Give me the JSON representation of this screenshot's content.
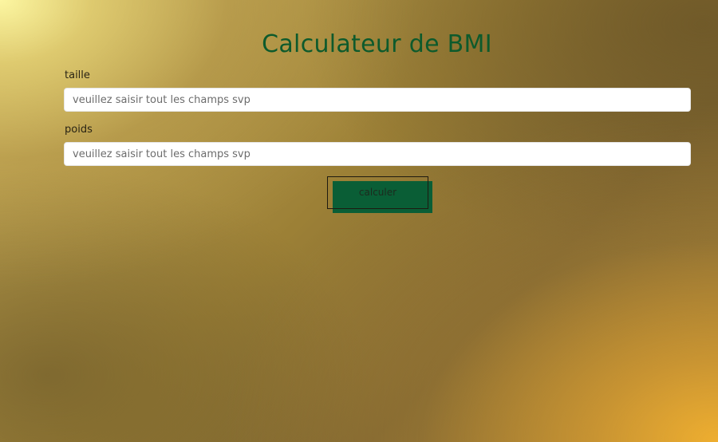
{
  "page": {
    "title": "Calculateur de BMI"
  },
  "form": {
    "height": {
      "label": "taille",
      "placeholder": "veuillez saisir tout les champs svp",
      "value": ""
    },
    "weight": {
      "label": "poids",
      "placeholder": "veuillez saisir tout les champs svp",
      "value": ""
    },
    "submit_label": "calculer"
  },
  "colors": {
    "title": "#0d5a2c",
    "button_fill": "#0a5e36",
    "input_background": "#ffffff"
  }
}
